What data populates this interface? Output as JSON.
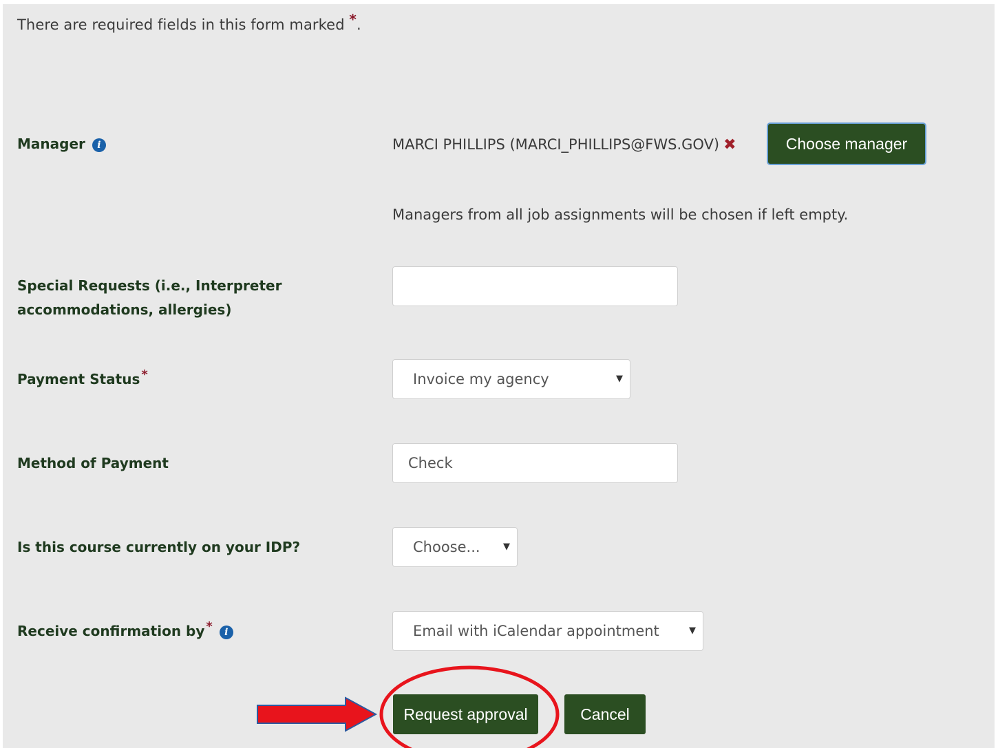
{
  "notice": {
    "text": "There are required fields in this form marked",
    "star": "*",
    "period": "."
  },
  "manager": {
    "label": "Manager",
    "info_icon": "info-circle-icon",
    "value": "MARCI PHILLIPS (MARCI_PHILLIPS@FWS.GOV)",
    "remove_icon": "close-icon",
    "remove_glyph": "✖",
    "choose_button": "Choose manager",
    "help": "Managers from all job assignments will be chosen if left empty."
  },
  "special_requests": {
    "label_line1": "Special Requests (i.e., Interpreter",
    "label_line2": "accommodations, allergies)",
    "value": ""
  },
  "payment_status": {
    "label": "Payment Status",
    "required": "*",
    "selected": "Invoice my agency"
  },
  "method_of_payment": {
    "label": "Method of Payment",
    "value": "Check"
  },
  "idp": {
    "label": "Is this course currently on your IDP?",
    "selected": "Choose..."
  },
  "confirmation": {
    "label": "Receive confirmation by",
    "required": "*",
    "info_icon": "info-circle-icon",
    "selected": "Email with iCalendar appointment"
  },
  "actions": {
    "request_approval": "Request approval",
    "cancel": "Cancel"
  },
  "select_arrow_glyph": "▼",
  "info_glyph": "i",
  "colors": {
    "panel_bg": "#e9e9e9",
    "label_text": "#1f3a1f",
    "button_bg": "#2b4e22",
    "required_star": "#8b1a2b",
    "info_icon": "#1a61a9",
    "annotation_red": "#e8141c",
    "annotation_arrow_outline": "#2c5aa0"
  },
  "annotations": {
    "arrow": "right-arrow-annotation",
    "circle": "ellipse-highlight-annotation"
  }
}
